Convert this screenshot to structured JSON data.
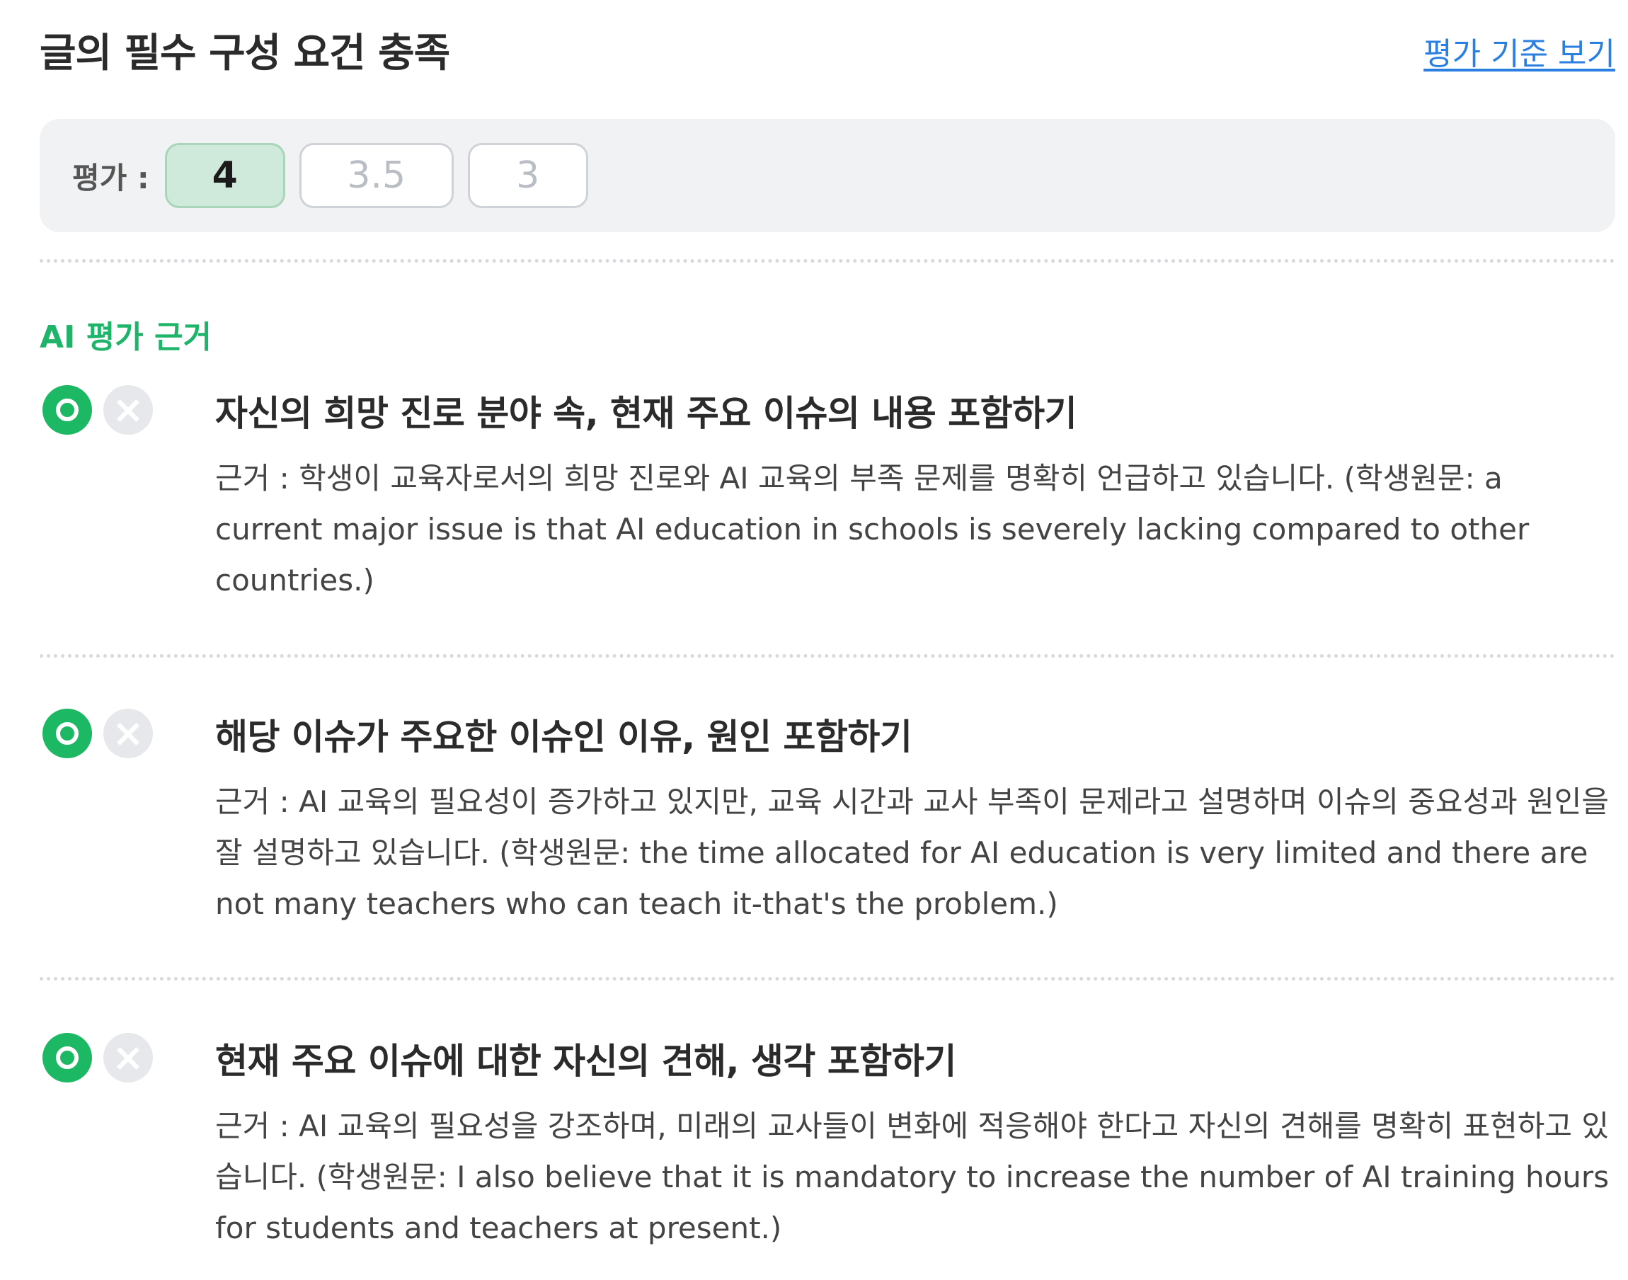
{
  "header": {
    "title": "글의 필수 구성 요건 충족",
    "criteria_link": "평가 기준 보기"
  },
  "rating": {
    "label": "평가 :",
    "options": [
      "4",
      "3.5",
      "3"
    ],
    "selected": "4"
  },
  "ai_section": {
    "label": "AI 평가 근거"
  },
  "items": [
    {
      "title": "자신의 희망 진로 분야 속, 현재 주요 이슈의 내용 포함하기",
      "reason": "근거 : 학생이 교육자로서의 희망 진로와 AI 교육의 부족 문제를 명확히 언급하고 있습니다. (학생원문: a current major issue is that AI education in schools is severely lacking compared to other countries.)",
      "status": "O"
    },
    {
      "title": "해당 이슈가 주요한 이슈인 이유, 원인 포함하기",
      "reason": "근거 : AI 교육의 필요성이 증가하고 있지만, 교육 시간과 교사 부족이 문제라고 설명하며 이슈의 중요성과 원인을 잘 설명하고 있습니다. (학생원문: the time allocated for AI education is very limited and there are not many teachers who can teach it-that's the problem.)",
      "status": "O"
    },
    {
      "title": "현재 주요 이슈에 대한 자신의 견해, 생각 포함하기",
      "reason": "근거 : AI 교육의 필요성을 강조하며, 미래의 교사들이 변화에 적응해야 한다고 자신의 견해를 명확히 표현하고 있습니다. (학생원문: I also believe that it is mandatory to increase the number of AI training hours for students and teachers at present.)",
      "status": "O"
    }
  ],
  "colors": {
    "accent_green": "#1db863",
    "selected_bg": "#cfe9db",
    "link_blue": "#2a7fe0"
  }
}
